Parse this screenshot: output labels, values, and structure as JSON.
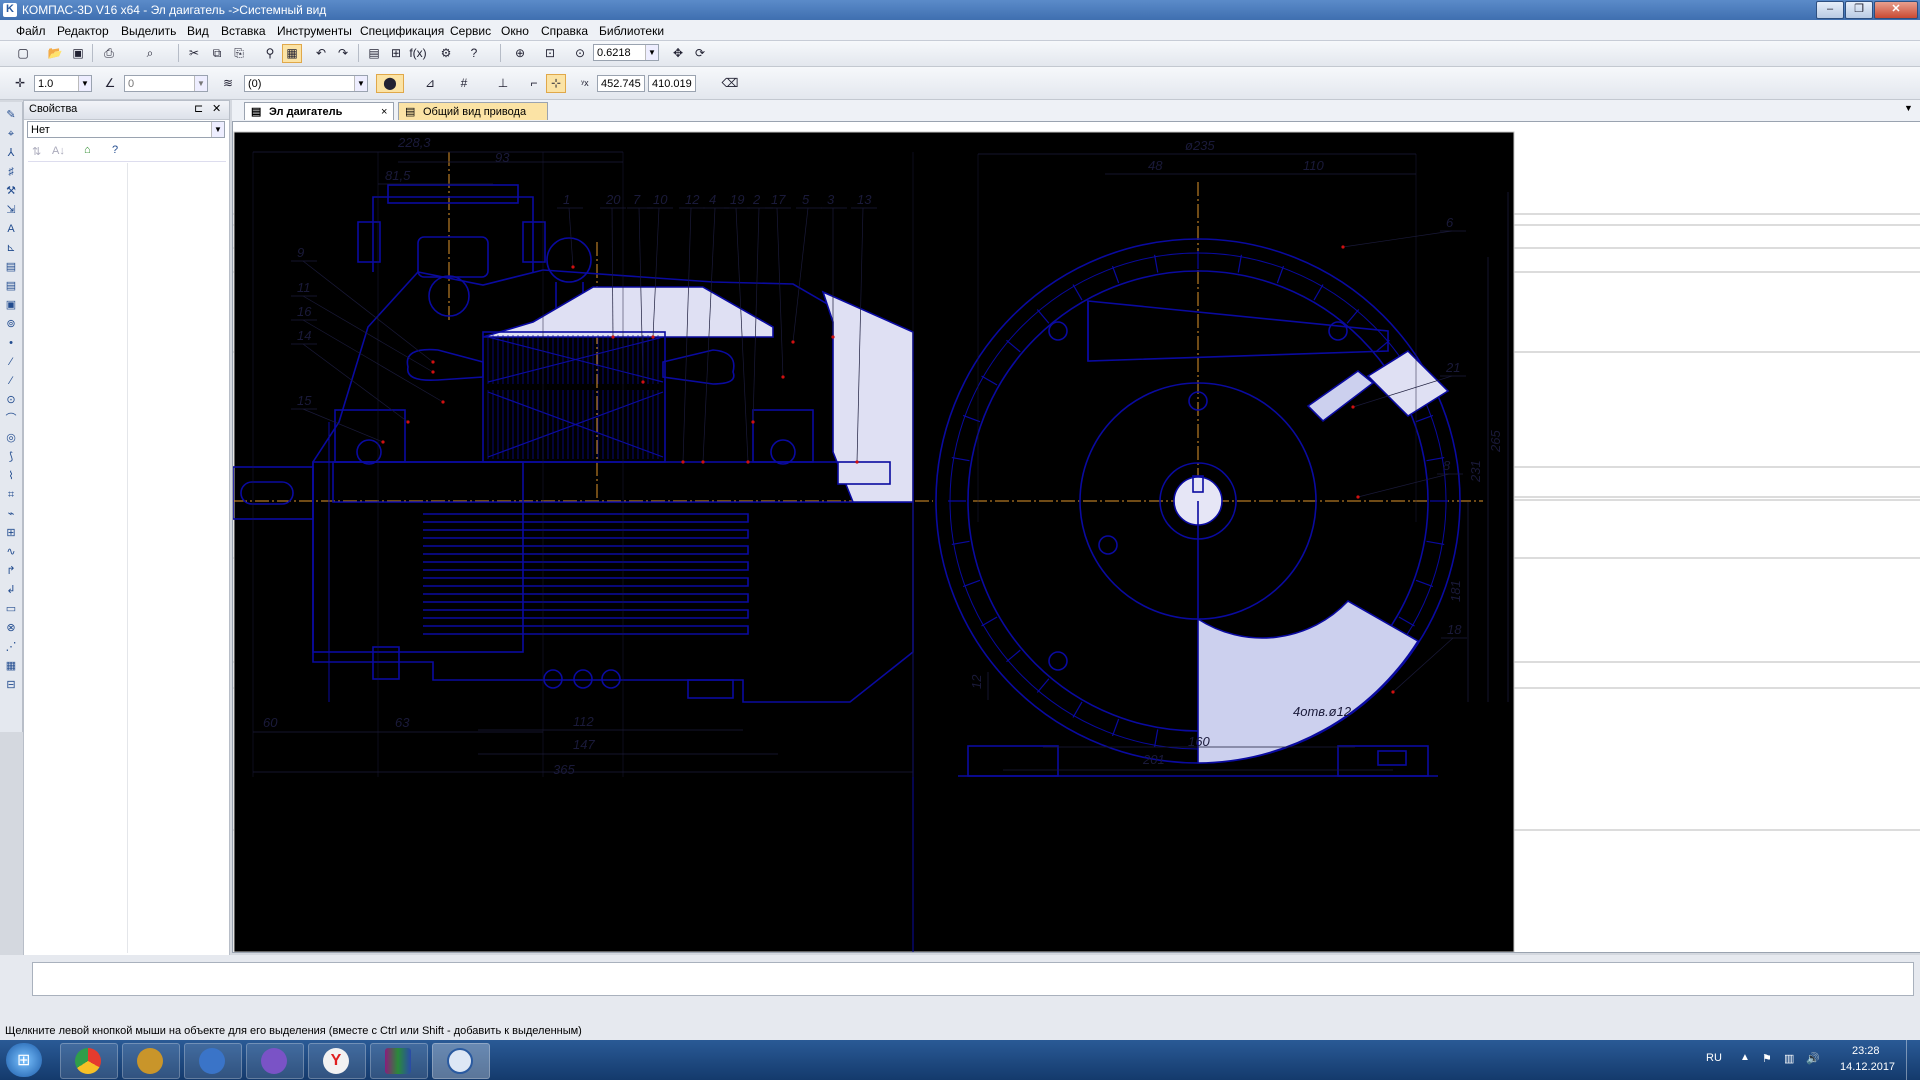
{
  "window": {
    "title": "КОМПАС-3D V16  x64 - Эл даигатель ->Системный вид"
  },
  "menu": [
    "Файл",
    "Редактор",
    "Выделить",
    "Вид",
    "Вставка",
    "Инструменты",
    "Спецификация",
    "Сервис",
    "Окно",
    "Справка",
    "Библиотеки"
  ],
  "toolbar1": {
    "zoom_value": "0.6218"
  },
  "toolbar2": {
    "step_value": "1.0",
    "angle_value": "0",
    "layer_value": "(0)",
    "coord_x": "452.745",
    "coord_y": "410.019"
  },
  "properties": {
    "title": "Свойства",
    "select_value": "Нет"
  },
  "tabs": [
    {
      "label": "Эл даигатель",
      "active": true
    },
    {
      "label": "Общий вид привода",
      "active": false
    }
  ],
  "drawing": {
    "dims": [
      "228,3",
      "93",
      "81,5",
      "60",
      "63",
      "112",
      "147",
      "365",
      "ø235",
      "48",
      "110",
      "265",
      "231",
      "181",
      "12",
      "160",
      "201",
      "4отв.ø12"
    ],
    "callouts": [
      "1",
      "20",
      "7",
      "10",
      "12",
      "4",
      "19",
      "2",
      "17",
      "5",
      "3",
      "13",
      "9",
      "11",
      "16",
      "14",
      "15",
      "6",
      "21",
      "8",
      "18"
    ],
    "colors": {
      "line": "#0a0aa0",
      "axis": "#e0962c",
      "hatch": "#1a1ab0",
      "marker": "#d01010"
    }
  },
  "status": {
    "text": "Щелкните левой кнопкой мыши на объекте для его выделения (вместе с Ctrl или Shift - добавить к выделенным)"
  },
  "taskbar": {
    "lang": "RU",
    "time": "23:28",
    "date": "14.12.2017"
  }
}
